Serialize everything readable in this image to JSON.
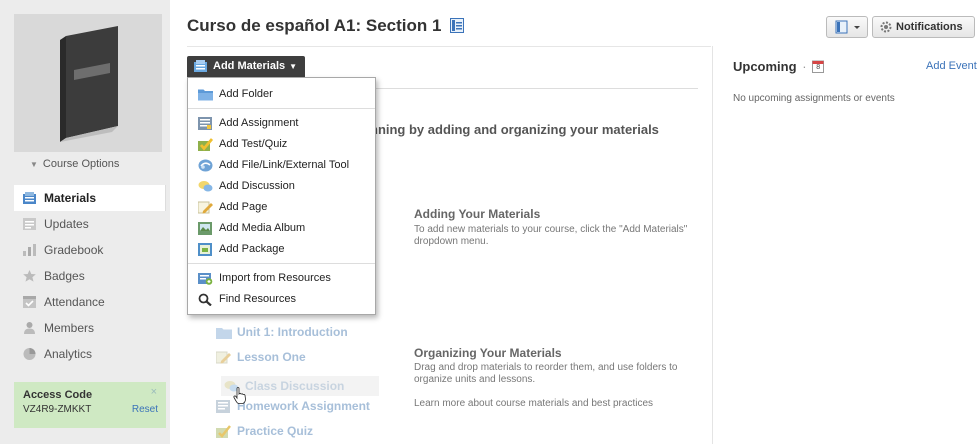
{
  "course": {
    "title": "Curso de español A1: Section 1"
  },
  "sidebar": {
    "course_options": "Course Options",
    "nav": [
      {
        "label": "Materials",
        "icon": "materials-icon",
        "active": true
      },
      {
        "label": "Updates",
        "icon": "updates-icon"
      },
      {
        "label": "Gradebook",
        "icon": "gradebook-icon"
      },
      {
        "label": "Badges",
        "icon": "badge-icon"
      },
      {
        "label": "Attendance",
        "icon": "attendance-icon"
      },
      {
        "label": "Members",
        "icon": "members-icon"
      },
      {
        "label": "Analytics",
        "icon": "analytics-icon"
      }
    ],
    "access_code": {
      "title": "Access Code",
      "code": "VZ4R9-ZMKKT",
      "reset": "Reset",
      "close": "×"
    }
  },
  "header": {
    "notifications": "Notifications"
  },
  "add_materials": {
    "label": "Add Materials",
    "menu": {
      "group1": [
        {
          "label": "Add Folder",
          "icon": "folder-icon"
        }
      ],
      "group2": [
        {
          "label": "Add Assignment",
          "icon": "assignment-icon"
        },
        {
          "label": "Add Test/Quiz",
          "icon": "quiz-icon"
        },
        {
          "label": "Add File/Link/External Tool",
          "icon": "link-icon"
        },
        {
          "label": "Add Discussion",
          "icon": "discussion-icon"
        },
        {
          "label": "Add Page",
          "icon": "page-icon"
        },
        {
          "label": "Add Media Album",
          "icon": "media-album-icon"
        },
        {
          "label": "Add Package",
          "icon": "package-icon"
        }
      ],
      "group3": [
        {
          "label": "Import from Resources",
          "icon": "import-icon"
        },
        {
          "label": "Find Resources",
          "icon": "search-icon"
        }
      ]
    }
  },
  "main": {
    "intro": "nning by adding and organizing your materials",
    "adding": {
      "title": "Adding Your Materials",
      "text": "To add new materials to your course, click the \"Add Materials\" dropdown menu."
    },
    "organizing": {
      "title": "Organizing Your Materials",
      "text": "Drag and drop materials to reorder them, and use folders to organize units and lessons.",
      "learn_more": "Learn more about course materials and best practices"
    },
    "samples": [
      {
        "label": "Unit 1: Introduction",
        "icon": "folder-icon"
      },
      {
        "label": "Lesson One",
        "icon": "page-icon"
      },
      {
        "label": "Class Discussion",
        "icon": "discussion-icon"
      },
      {
        "label": "Homework Assignment",
        "icon": "assignment-icon"
      },
      {
        "label": "Practice Quiz",
        "icon": "quiz-icon"
      }
    ]
  },
  "upcoming": {
    "title": "Upcoming",
    "separator": "·",
    "calendar_day": "8",
    "add_event": "Add Event",
    "empty": "No upcoming assignments or events"
  }
}
